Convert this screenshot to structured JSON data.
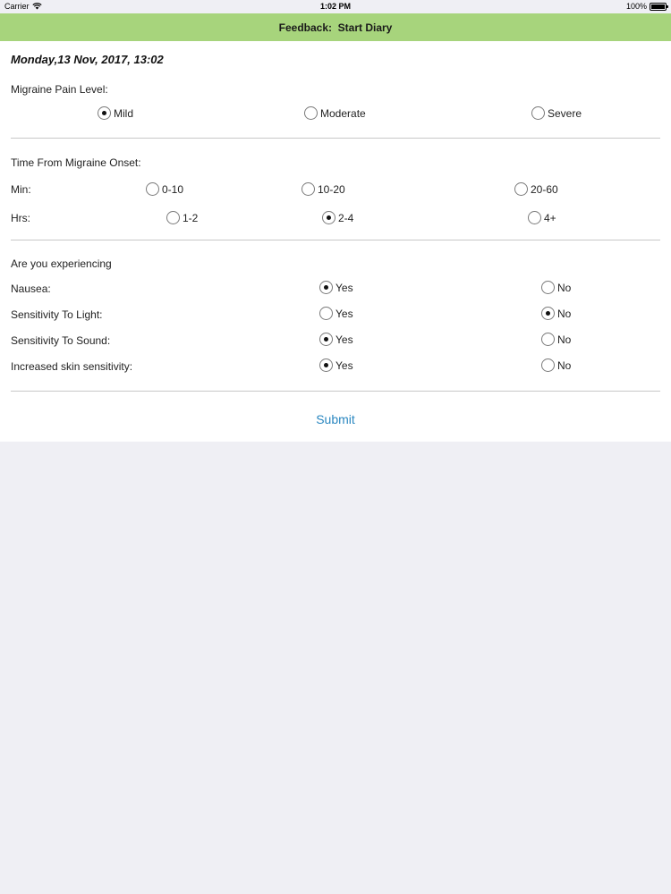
{
  "status_bar": {
    "carrier": "Carrier",
    "time": "1:02 PM",
    "battery": "100%"
  },
  "navbar": {
    "title": "Feedback:  Start Diary"
  },
  "date": "Monday,13 Nov, 2017, 13:02",
  "pain": {
    "label": "Migraine Pain Level:",
    "options": [
      "Mild",
      "Moderate",
      "Severe"
    ],
    "selected": "Mild"
  },
  "onset": {
    "label": "Time From Migraine Onset:",
    "min_label": "Min:",
    "min_options": [
      "0-10",
      "10-20",
      "20-60"
    ],
    "hrs_label": "Hrs:",
    "hrs_options": [
      "1-2",
      "2-4",
      "4+"
    ],
    "selected_hrs": "2-4"
  },
  "symptoms": {
    "label": "Are you experiencing",
    "yes": "Yes",
    "no": "No",
    "rows": [
      {
        "label": "Nausea:",
        "answer": "Yes"
      },
      {
        "label": "Sensitivity To Light:",
        "answer": "No"
      },
      {
        "label": "Sensitivity To Sound:",
        "answer": "Yes"
      },
      {
        "label": "Increased skin sensitivity:",
        "answer": "Yes"
      }
    ]
  },
  "submit_label": "Submit"
}
